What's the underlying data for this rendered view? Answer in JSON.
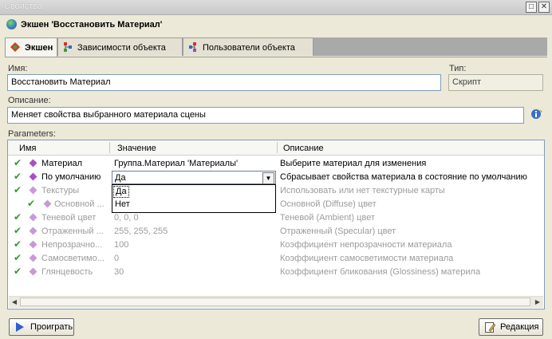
{
  "window": {
    "title": "Свойства",
    "min_btn": "□",
    "close_btn": "✕"
  },
  "header": {
    "title": "Экшен 'Восстановить Материал'"
  },
  "tabs": [
    {
      "label": "Экшен"
    },
    {
      "label": "Зависимости объекта"
    },
    {
      "label": "Пользователи объекта"
    }
  ],
  "form": {
    "name_label": "Имя:",
    "name_value": "Восстановить Материал",
    "type_label": "Тип:",
    "type_value": "Скрипт",
    "desc_label": "Описание:",
    "desc_value": "Меняет свойства выбранного материала сцены",
    "params_label": "Parameters:"
  },
  "grid": {
    "headers": {
      "name": "Имя",
      "value": "Значение",
      "description": "Описание"
    },
    "rows": [
      {
        "name": "Материал",
        "value": "Группа.Материал 'Материалы'",
        "description": "Выберите материал для изменения"
      },
      {
        "name": "По умолчанию",
        "value": "Да",
        "description": "Сбрасывает свойства материала в состояние по умолчанию"
      },
      {
        "name": "Текстуры",
        "value": "",
        "description": "Использовать или нет текстурные карты"
      },
      {
        "name": "Основной ...",
        "value": "",
        "description": "Основной (Diffuse) цвет"
      },
      {
        "name": "Теневой цвет",
        "value": "0, 0, 0",
        "description": "Теневой (Ambient) цвет"
      },
      {
        "name": "Отраженный ...",
        "value": "255, 255, 255",
        "description": "Отраженный (Specular) цвет"
      },
      {
        "name": "Непрозрачно...",
        "value": "100",
        "description": "Коэффициент непрозрачности материала"
      },
      {
        "name": "Самосветимо...",
        "value": "0",
        "description": "Коэффициент самосветимости материала"
      },
      {
        "name": "Глянцевость",
        "value": "30",
        "description": "Коэффициент бликования (Glossiness) материла"
      }
    ],
    "dropdown": {
      "selected": "Да",
      "options": [
        "Да",
        "Нет"
      ]
    }
  },
  "buttons": {
    "play": "Проиграть",
    "edit": "Редакция"
  },
  "colors": {
    "accent_check": "#2f9a2f",
    "param_gem": "#a94fc4",
    "bg": "#ece9d8"
  }
}
